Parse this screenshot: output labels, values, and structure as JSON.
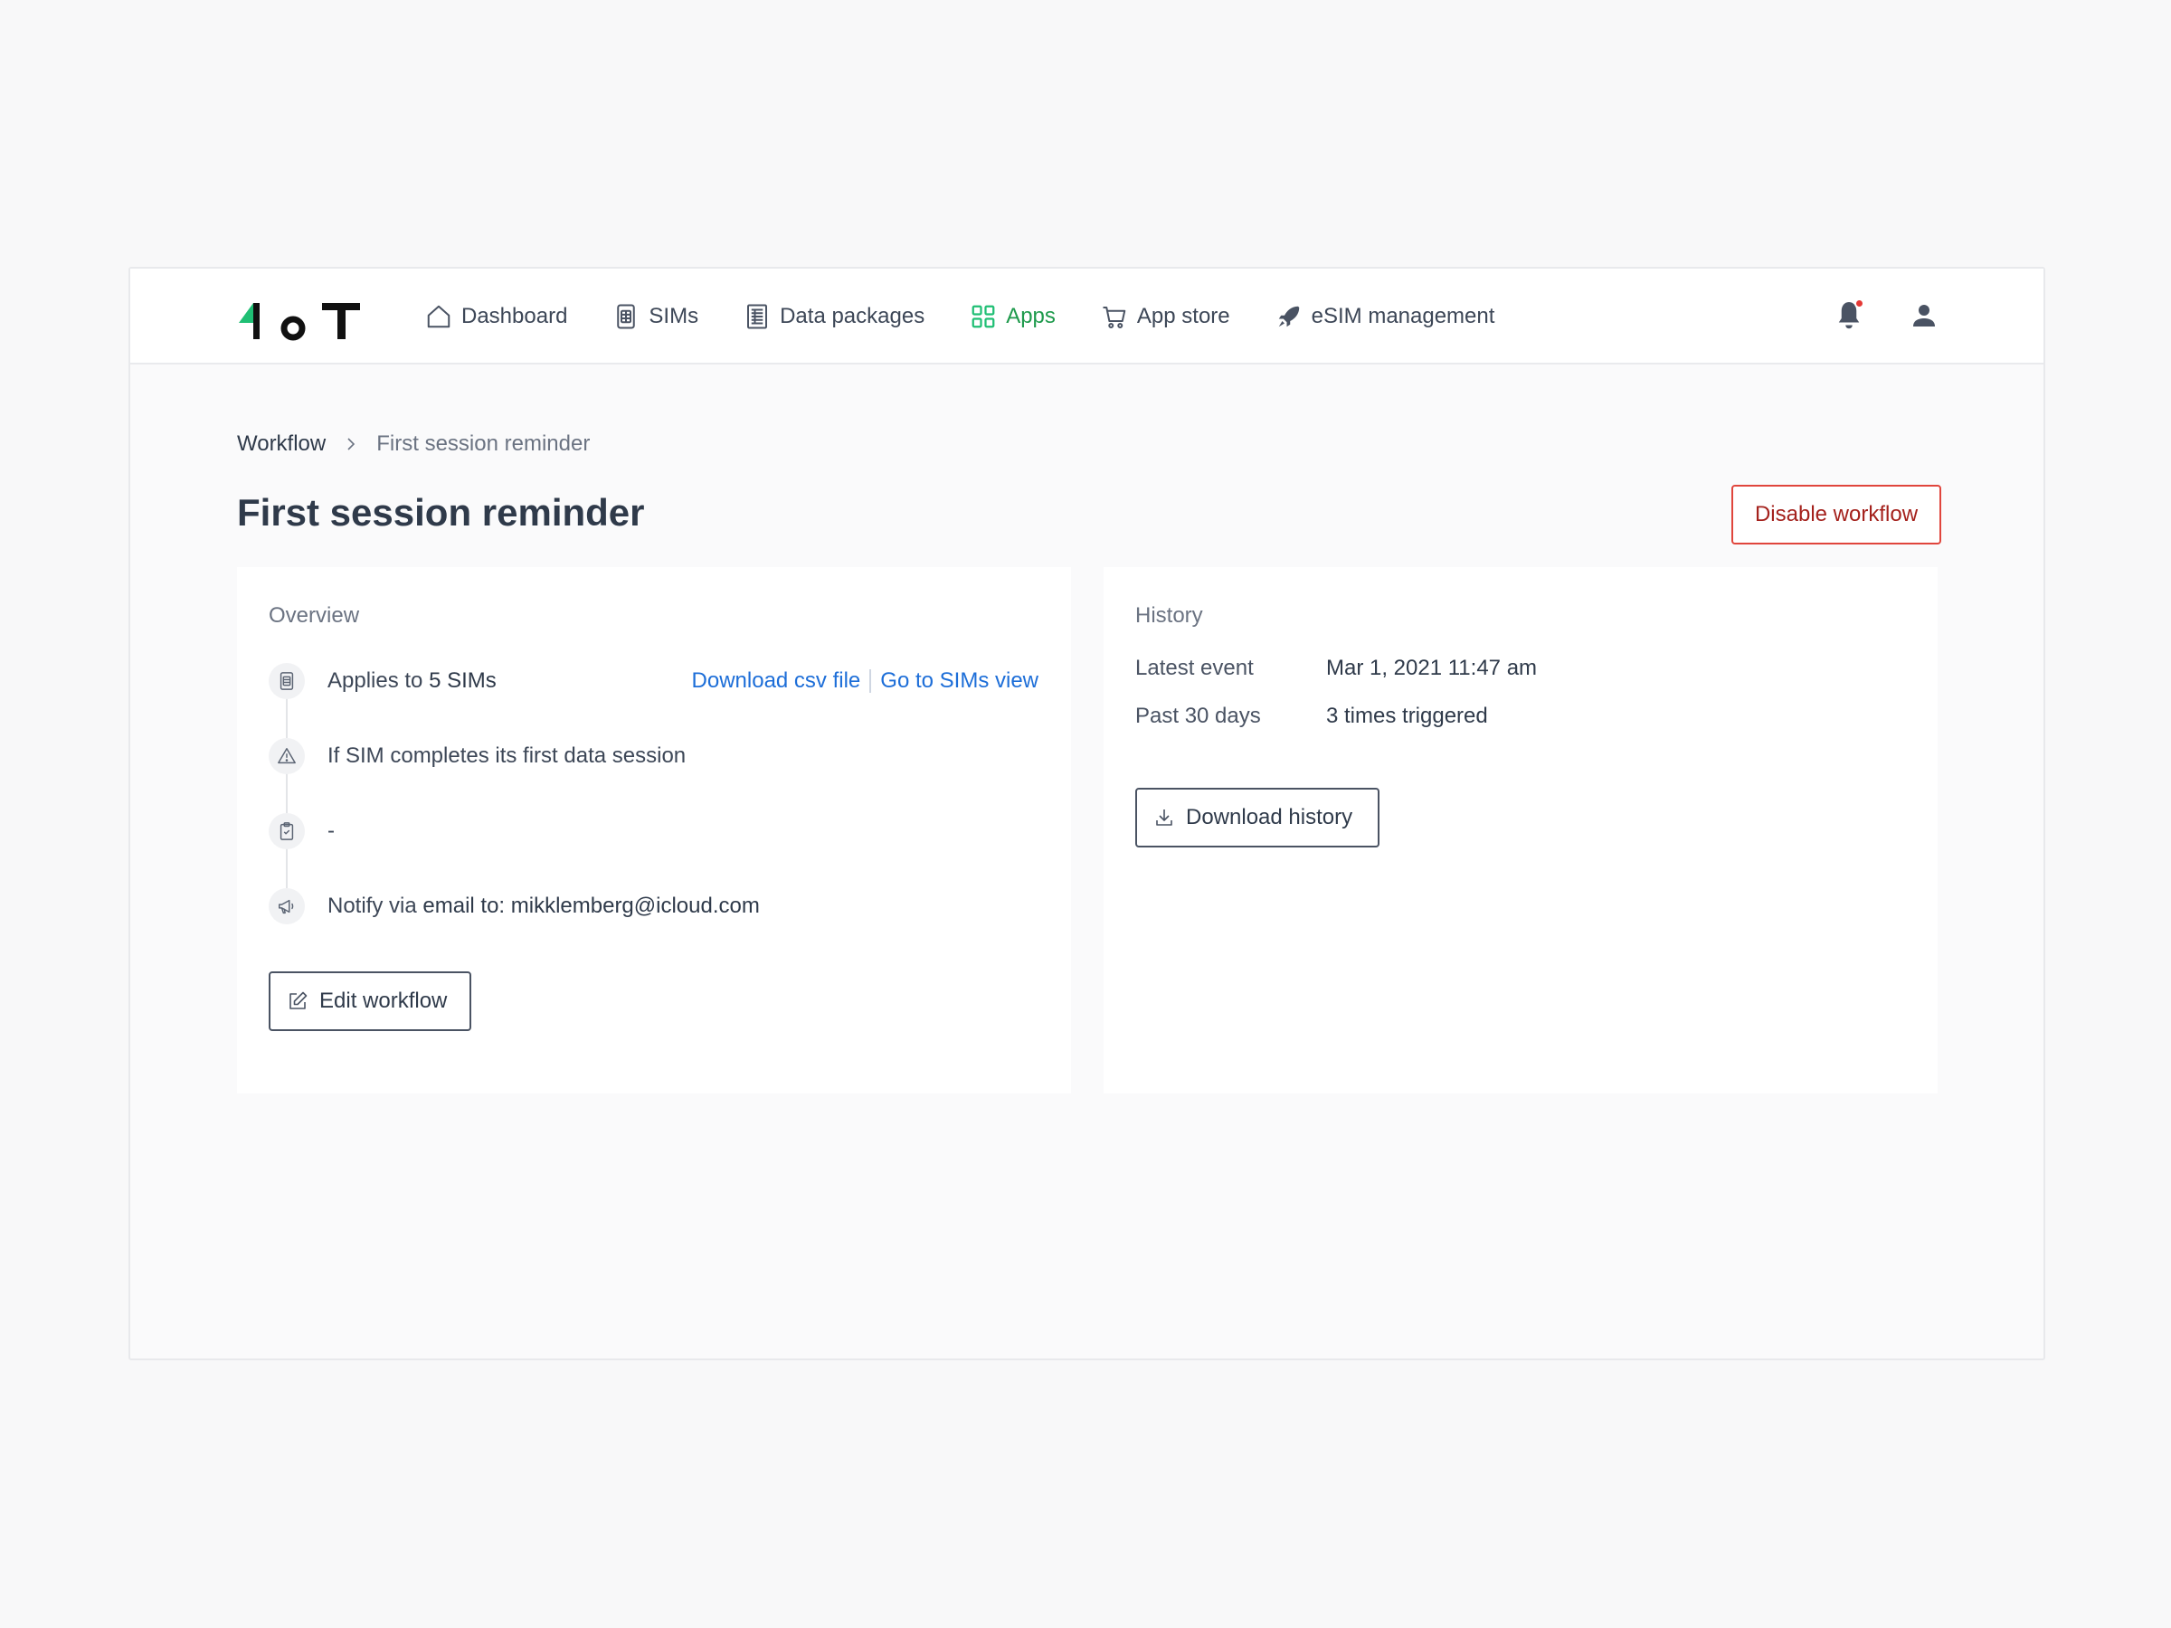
{
  "brand": {
    "logo_text": "1oT",
    "accent_color": "#1fbf74",
    "active_color": "#1e9a4c",
    "danger_color": "#e0453c",
    "link_color": "#1d6ed8"
  },
  "nav": {
    "items": [
      {
        "label": "Dashboard",
        "icon": "home-icon"
      },
      {
        "label": "SIMs",
        "icon": "sim-card-icon"
      },
      {
        "label": "Data packages",
        "icon": "document-list-icon"
      },
      {
        "label": "Apps",
        "icon": "apps-grid-icon",
        "active": true
      },
      {
        "label": "App store",
        "icon": "cart-icon"
      },
      {
        "label": "eSIM management",
        "icon": "rocket-icon"
      }
    ],
    "notifications_unread": true
  },
  "breadcrumb": {
    "parent": "Workflow",
    "current": "First session reminder"
  },
  "page": {
    "title": "First session reminder",
    "disable_label": "Disable workflow"
  },
  "overview": {
    "label": "Overview",
    "applies_prefix": "Applies to ",
    "applies_count": "5 SIMs",
    "download_csv": "Download csv file",
    "go_to_sims": "Go to SIMs view",
    "condition": "If SIM completes its first data session",
    "action_value": "-",
    "notify_prefix": "Notify via ",
    "notify_target": "email to: mikklemberg@icloud.com",
    "edit_label": "Edit workflow"
  },
  "history": {
    "label": "History",
    "rows": [
      {
        "key": "Latest event",
        "value": "Mar 1, 2021 11:47 am"
      },
      {
        "key": "Past 30 days",
        "value": "3 times triggered"
      }
    ],
    "download_label": "Download history"
  }
}
